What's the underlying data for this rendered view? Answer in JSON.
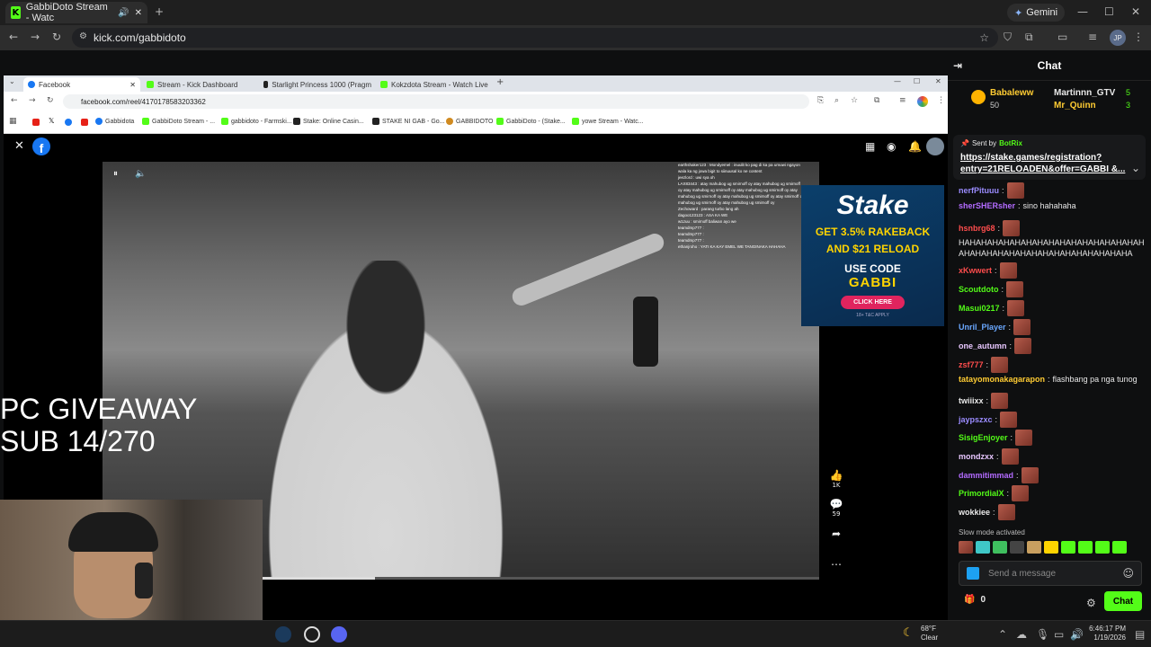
{
  "outer_browser": {
    "tab_title": "GabbiDoto Stream - Watc",
    "url": "kick.com/gabbidoto",
    "gemini_label": "Gemini",
    "profile_initials": "JP"
  },
  "inner_browser": {
    "tabs": [
      {
        "label": "Facebook",
        "active": true
      },
      {
        "label": "Stream - Kick Dashboard",
        "active": false
      },
      {
        "label": "Starlight Princess 1000 (Pragm",
        "active": false
      },
      {
        "label": "Kokzdota Stream - Watch Live",
        "active": false
      }
    ],
    "url": "facebook.com/reel/4170178583203362",
    "bookmarks": [
      "Gabbidota",
      "GabbiDoto Stream - ...",
      "gabbidoto - Farmski...",
      "Stake: Online Casin...",
      "STAKE NI GAB - Go...",
      "GABBIDOTO",
      "GabbiDoto - (Stake...",
      "yowe Stream - Watc..."
    ]
  },
  "reel": {
    "like_count": "1K",
    "comment_count": "59",
    "chat_overlay": [
      "earthshaker123 : Mondyemel : inuulit ko pag di ka pa umuwi ngayon",
      "wala ka ng jowa bigit to siinuusal ko ne content",
      "jeezlord : uwi sya oh",
      "LAX83443 : atay mahubog ug smirnoff oy atay mahubog ug smirnoff",
      "oy atay mahubog ug smirnoff oy atay mahubog ug smirnoff oy atay",
      "mahubog ug smirnoff oy atay mahubog ug smirnoff oy atay smirnoff oy",
      "mahubog ug smirnoff oy atay mahubog ug smirnoff oy",
      "Zechoward : parang turbo lang ah",
      "dagoo123123 : ASA KA WE",
      "w1zuu : smirnoff baliwan ayo we",
      "teamdmp777 :",
      "teamdmp777 :",
      "teamdmp777 :",
      "ethanjroho : YATI KA KAY EMEL WE TANGINAKA HAHAHA"
    ]
  },
  "stake_ad": {
    "logo": "Stake",
    "line1": "GET 3.5% RAKEBACK",
    "line2": "AND $21 RELOAD",
    "line3": "USE CODE",
    "code": "GABBI",
    "button": "CLICK HERE",
    "tc": "18+ T&C APPLY"
  },
  "overlay": {
    "line1": "PC GIVEAWAY",
    "line2": "SUB 14/270"
  },
  "chat": {
    "title": "Chat",
    "top_gifters": [
      {
        "name": "Babaleww",
        "count": "50"
      },
      {
        "name": "Martinnn_GTV",
        "count": "5"
      },
      {
        "name": "Mr_Quinn",
        "count": "3"
      }
    ],
    "pinned": {
      "sent_by_label": "Sent by",
      "sender": "BotRix",
      "link_line1": "https://stake.games/registration?",
      "link_line2": "entry=21RELOADEN&offer=GABBI &..."
    },
    "messages": [
      {
        "user": "nerfPituuu",
        "color": "#9b8cff",
        "text": ""
      },
      {
        "user": "sherSHERsher",
        "color": "#b36bff",
        "text": "sino hahahaha"
      },
      {
        "user": "hsnbrg68",
        "color": "#ff4d4d",
        "text": ""
      },
      {
        "user": "",
        "color": "#e8e8e8",
        "text": "HAHAHAHAHAHAHAHAHAHAHAHAHAHAHAHAH"
      },
      {
        "user": "",
        "color": "#e8e8e8",
        "text": "AHAHAHAHAHAHAHAHAHAHAHAHAHAHAHA"
      },
      {
        "user": "xKwwert",
        "color": "#ff4d4d",
        "text": ""
      },
      {
        "user": "Scoutdoto",
        "color": "#53fc18",
        "text": ""
      },
      {
        "user": "Masui0217",
        "color": "#53fc18",
        "text": ""
      },
      {
        "user": "Unril_Player",
        "color": "#6aa8ff",
        "text": ""
      },
      {
        "user": "one_autumn",
        "color": "#e8c7ff",
        "text": ""
      },
      {
        "user": "zsf777",
        "color": "#ff4d4d",
        "text": ""
      },
      {
        "user": "tatayomonakagarapon",
        "color": "#ffcc33",
        "text": "flashbang pa nga tunog"
      },
      {
        "user": "twiiixx",
        "color": "#e8e8e8",
        "text": ""
      },
      {
        "user": "jaypszxc",
        "color": "#9b8cff",
        "text": ""
      },
      {
        "user": "SisigEnjoyer",
        "color": "#53fc18",
        "text": ""
      },
      {
        "user": "mondzxx",
        "color": "#e8c7ff",
        "text": ""
      },
      {
        "user": "dammitimmad",
        "color": "#b36bff",
        "text": ""
      },
      {
        "user": "PrimordialX",
        "color": "#53fc18",
        "text": ""
      },
      {
        "user": "wokkiee",
        "color": "#e8e8e8",
        "text": ""
      }
    ],
    "slow_mode": "Slow mode activated",
    "input_placeholder": "Send a message",
    "points": "0",
    "chat_button": "Chat"
  },
  "taskbar": {
    "weather_temp": "68°F",
    "weather_desc": "Clear",
    "time": "6:46:17 PM",
    "date": "1/19/2026"
  },
  "colors": {
    "kick_green": "#53fc18",
    "chat_bg": "#0e0f10",
    "stake_blue": "#0b3f6b"
  }
}
